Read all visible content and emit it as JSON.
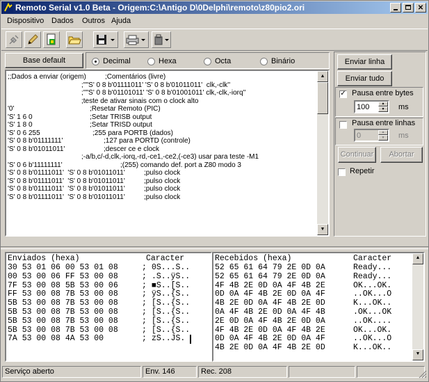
{
  "window": {
    "title": "Remoto Serial v1.0 Beta  - Origem:C:\\Antigo D\\0Delphi\\remoto\\z80pio2.ori"
  },
  "menu": [
    "Dispositivo",
    "Dados",
    "Outros",
    "Ajuda"
  ],
  "format": {
    "base_default_label": "Base default",
    "options": [
      "Decimal",
      "Hexa",
      "Octa",
      "Binário"
    ],
    "selected": "Decimal"
  },
  "editor_lines": [
    [
      ";;Dados a enviar (origem)",
      ";Comentários (livre)"
    ],
    [
      "",
      ";''\"S' 0 8 b'01111011' 'S' 0 8 b'01011011'  clk,-clk''"
    ],
    [
      "",
      ";''\"S' 0 8 b'01101011' 'S' 0 8 b'01001011' clk,-clk,-iorq''"
    ],
    [
      "",
      ";teste de ativar sinais com o clock alto"
    ],
    [
      "'0'",
      ";Resetar Remoto (PIC)"
    ],
    [
      "'S' 1 6 0",
      ";Setar TRISB output"
    ],
    [
      "'S' 1 8 0",
      ";Setar TRISD output"
    ],
    [
      "'S' 0 6 255",
      ";255 para PORTB (dados)"
    ],
    [
      "'S' 0 8 b'01111111'",
      ";127 para PORTD (controle)"
    ],
    [
      "'S' 0 8 b'01011011'",
      ";descer ce e clock"
    ],
    [
      "",
      ";-a/b,c/-d,clk,-iorq,-rd,-ce1,-ce2,(-ce3) usar para teste -M1"
    ],
    [
      "'S' 0 6 b'11111111'",
      ";(255) comando def. port a Z80 modo 3"
    ],
    [
      "'S' 0 8 b'01111011'  'S' 0 8 b'01011011'",
      ";pulso clock"
    ],
    [
      "'S' 0 8 b'01111011'  'S' 0 8 b'01011011'",
      ";pulso clock"
    ],
    [
      "'S' 0 8 b'01111011'  'S' 0 8 b'01011011'",
      ";pulso clock"
    ],
    [
      "'S' 0 8 b'01111011'  'S' 0 8 b'01011011'",
      ";pulso clock"
    ]
  ],
  "actions": {
    "enviar_linha": "Enviar linha",
    "enviar_tudo": "Enviar tudo",
    "pausa_bytes_label": "Pausa entre bytes",
    "pausa_bytes_value": "100",
    "pausa_bytes_unit": "ms",
    "pausa_linhas_label": "Pausa entre linhas",
    "pausa_linhas_value": "0",
    "pausa_linhas_unit": "ms",
    "continuar": "Continuar",
    "abortar": "Abortar",
    "repetir": "Repetir"
  },
  "sent": {
    "header": "Enviados (hexa)",
    "char_header": "Caracter",
    "rows": [
      [
        "30 53 01 06 00 53 01 08",
        ";",
        "0S...S.."
      ],
      [
        "00 53 00 06 FF 53 00 08",
        ";",
        ".S..ÿS.."
      ],
      [
        "7F 53 00 08 5B 53 00 06",
        ";",
        "■S..[S.."
      ],
      [
        "FF 53 00 08 7B 53 00 08",
        ";",
        "ÿS..{S.."
      ],
      [
        "5B 53 00 08 7B 53 00 08",
        ";",
        "[S..{S.."
      ],
      [
        "5B 53 00 08 7B 53 00 08",
        ";",
        "[S..{S.."
      ],
      [
        "5B 53 00 08 7B 53 00 08",
        ";",
        "[S..{S.."
      ],
      [
        "5B 53 00 08 7B 53 00 08",
        ";",
        "[S..{S.."
      ],
      [
        "7A 53 00 08 4A 53 00",
        ";",
        "zS..JS."
      ]
    ]
  },
  "received": {
    "header": "Recebidos (hexa)",
    "char_header": "Caracter",
    "rows": [
      [
        "52 65 61 64 79 2E 0D 0A",
        "Ready..."
      ],
      [
        "52 65 61 64 79 2E 0D 0A",
        "Ready..."
      ],
      [
        "4F 4B 2E 0D 0A 4F 4B 2E",
        "OK...OK."
      ],
      [
        "0D 0A 4F 4B 2E 0D 0A 4F",
        "..OK...O"
      ],
      [
        "4B 2E 0D 0A 4F 4B 2E 0D",
        "K...OK.."
      ],
      [
        "0A 4F 4B 2E 0D 0A 4F 4B",
        ".OK...OK"
      ],
      [
        "2E 0D 0A 4F 4B 2E 0D 0A",
        "..OK...."
      ],
      [
        "4F 4B 2E 0D 0A 4F 4B 2E",
        "OK...OK."
      ],
      [
        "0D 0A 4F 4B 2E 0D 0A 4F",
        "..OK...O"
      ],
      [
        "4B 2E 0D 0A 4F 4B 2E 0D",
        "K...OK.."
      ]
    ]
  },
  "status": {
    "service": "Serviço aberto",
    "sent_count": "Env. 146",
    "recv_count": "Rec. 208"
  },
  "colors": {
    "title_start": "#0a246a",
    "title_end": "#a6caf0",
    "face": "#d4d0c8"
  }
}
